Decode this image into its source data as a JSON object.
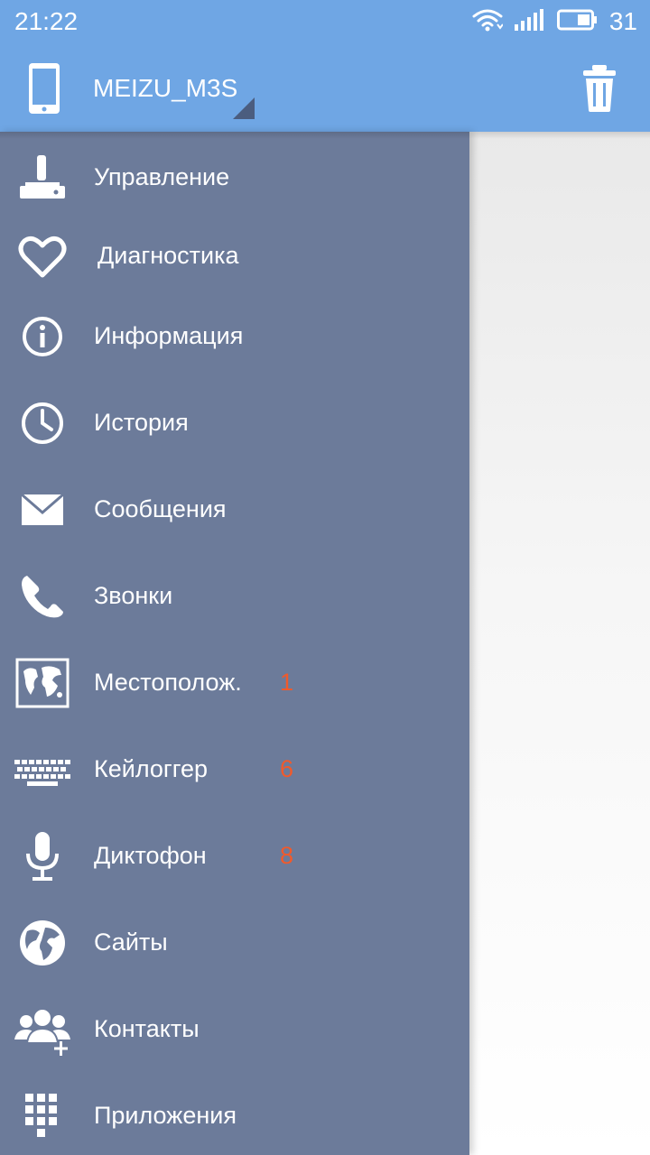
{
  "status": {
    "time": "21:22",
    "battery": "31",
    "wifi_icon": "wifi-icon",
    "signal_icon": "signal-icon",
    "battery_icon": "battery-icon"
  },
  "app_bar": {
    "device_name": "MEIZU_M3S",
    "device_icon": "phone-icon",
    "trash_icon": "trash-icon"
  },
  "menu": {
    "items": [
      {
        "label": "Управление",
        "icon": "joystick-icon",
        "badge": ""
      },
      {
        "label": "Диагностика",
        "icon": "heart-icon",
        "badge": ""
      },
      {
        "label": "Информация",
        "icon": "info-icon",
        "badge": ""
      },
      {
        "label": "История",
        "icon": "clock-icon",
        "badge": ""
      },
      {
        "label": "Сообщения",
        "icon": "envelope-icon",
        "badge": ""
      },
      {
        "label": "Звонки",
        "icon": "phone-handset-icon",
        "badge": ""
      },
      {
        "label": "Местополож.",
        "icon": "map-icon",
        "badge": "1"
      },
      {
        "label": "Кейлоггер",
        "icon": "keyboard-icon",
        "badge": "6"
      },
      {
        "label": "Диктофон",
        "icon": "microphone-icon",
        "badge": "8"
      },
      {
        "label": "Сайты",
        "icon": "globe-icon",
        "badge": ""
      },
      {
        "label": "Контакты",
        "icon": "contacts-add-icon",
        "badge": ""
      },
      {
        "label": "Приложения",
        "icon": "apps-grid-icon",
        "badge": ""
      }
    ]
  },
  "colors": {
    "app_bar": "#6fa6e4",
    "drawer": "#6c7b9a",
    "badge": "#f15a2b",
    "text": "#ffffff"
  }
}
